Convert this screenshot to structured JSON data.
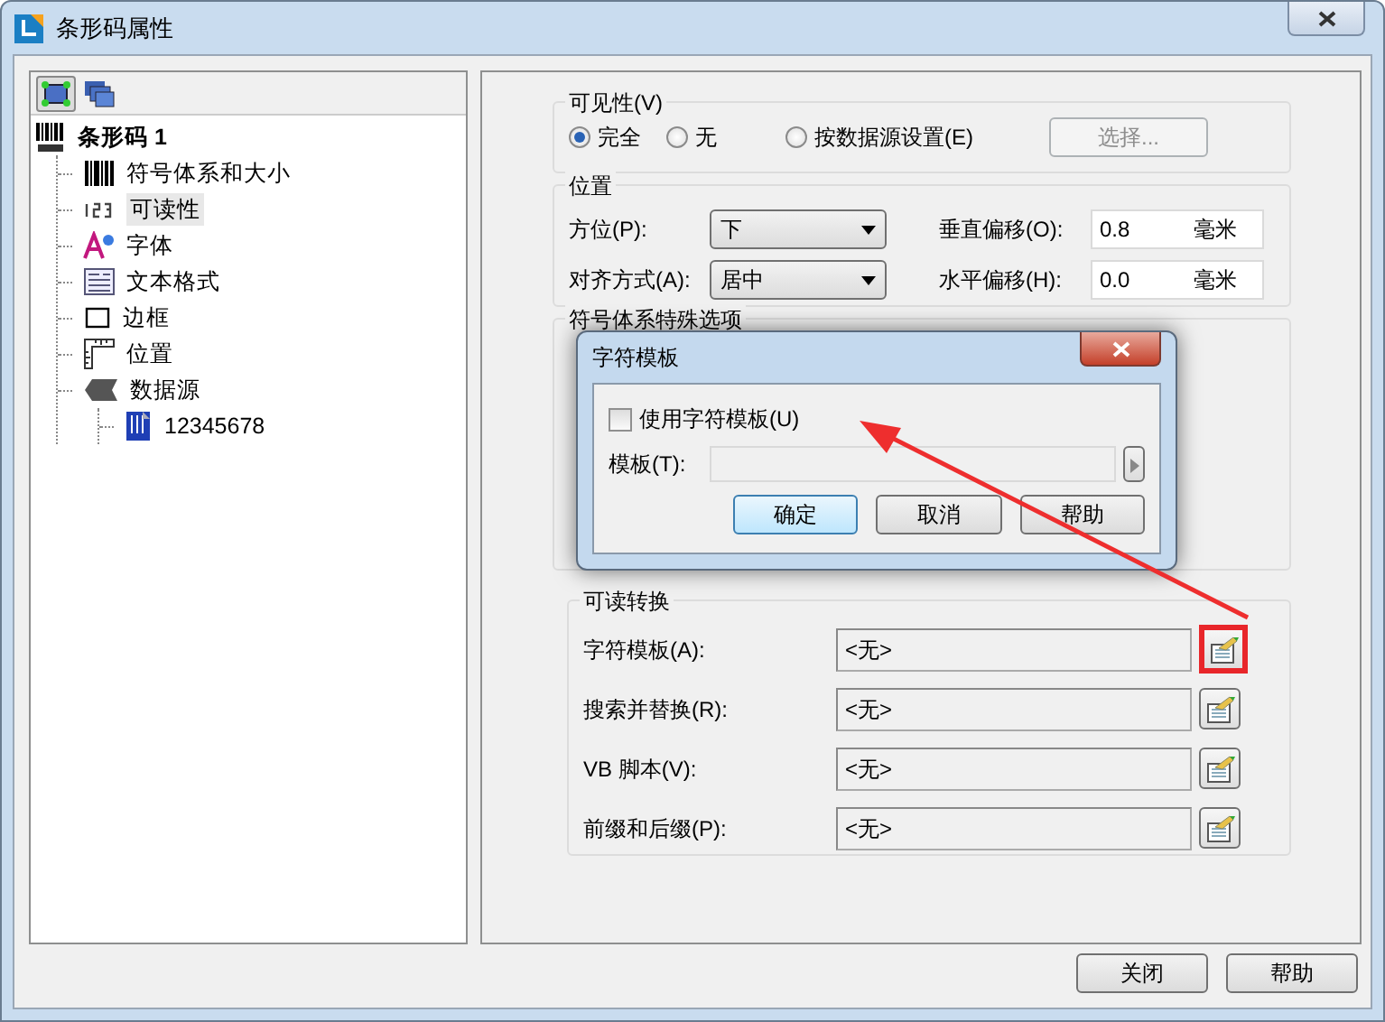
{
  "window": {
    "title": "条形码属性"
  },
  "toolbar": [
    {
      "kind": "frame",
      "selected": true
    },
    {
      "kind": "layers",
      "selected": false
    }
  ],
  "tree": [
    {
      "label": "条形码 1",
      "kind": "barcode",
      "selected": false,
      "children": [
        {
          "label": "符号体系和大小",
          "kind": "bars",
          "selected": false
        },
        {
          "label": "可读性",
          "kind": "digits",
          "selected": true
        },
        {
          "label": "字体",
          "kind": "font",
          "selected": false
        },
        {
          "label": "文本格式",
          "kind": "textformat",
          "selected": false
        },
        {
          "label": "边框",
          "kind": "border",
          "selected": false
        },
        {
          "label": "位置",
          "kind": "ruler",
          "selected": false
        },
        {
          "label": "数据源",
          "kind": "datasource",
          "selected": false,
          "children": [
            {
              "label": "12345678",
              "kind": "value",
              "selected": false
            }
          ]
        }
      ]
    }
  ],
  "visibility": {
    "title": "可见性(V)",
    "options": [
      {
        "label": "完全",
        "selected": true
      },
      {
        "label": "无",
        "selected": false
      },
      {
        "label": "按数据源设置(E)",
        "selected": false
      }
    ],
    "button": {
      "label": "选择...",
      "disabled": true
    }
  },
  "position": {
    "title": "位置",
    "dropdowns": [
      {
        "label": "方位(P):",
        "value": "下"
      },
      {
        "label": "对齐方式(A):",
        "value": "居中"
      }
    ],
    "offsets": [
      {
        "label": "垂直偏移(O):",
        "value": "0.8",
        "unit": "毫米"
      },
      {
        "label": "水平偏移(H):",
        "value": "0.0",
        "unit": "毫米"
      }
    ]
  },
  "symbology_options": {
    "title": "符号体系特殊选项"
  },
  "readable_conversion": {
    "title": "可读转换",
    "rows": [
      {
        "label": "字符模板(A):",
        "value": "<无>",
        "highlighted": true
      },
      {
        "label": "搜索并替换(R):",
        "value": "<无>",
        "highlighted": false
      },
      {
        "label": "VB 脚本(V):",
        "value": "<无>",
        "highlighted": false
      },
      {
        "label": "前缀和后缀(P):",
        "value": "<无>",
        "highlighted": false
      }
    ]
  },
  "dialog": {
    "title": "字符模板",
    "checkbox": {
      "label": "使用字符模板(U)",
      "checked": false
    },
    "template_label": "模板(T):",
    "buttons": [
      {
        "label": "确定",
        "default": true
      },
      {
        "label": "取消",
        "default": false
      },
      {
        "label": "帮助",
        "default": false
      }
    ]
  },
  "footer_buttons": [
    "关闭",
    "帮助"
  ]
}
